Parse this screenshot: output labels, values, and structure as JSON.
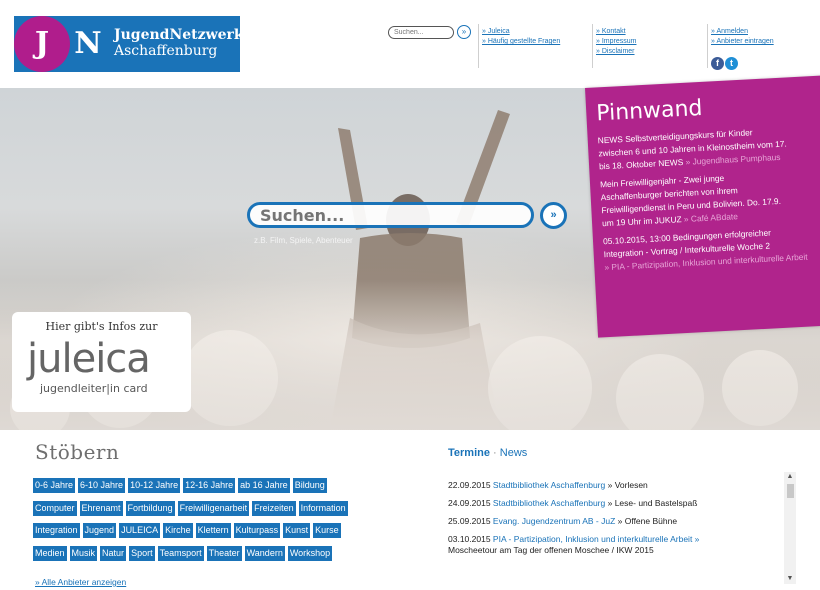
{
  "header": {
    "logo": {
      "letter_j": "J",
      "letter_n": "N",
      "line1": "JugendNetzwerk",
      "line2": "Aschaffenburg"
    },
    "search": {
      "placeholder": "Suchen...",
      "button": "»"
    },
    "links_col1": [
      "» Juleica",
      "» Häufig gestellte Fragen"
    ],
    "links_col2": [
      "» Kontakt",
      "» Impressum",
      "» Disclaimer"
    ],
    "links_col3": [
      "» Anmelden",
      "» Anbieter eintragen"
    ],
    "social": {
      "facebook": "f",
      "twitter": "t"
    }
  },
  "hero": {
    "search_placeholder": "Suchen...",
    "search_button": "»",
    "search_hint": "z.B. Film, Spiele, Abenteuer"
  },
  "juleica_card": {
    "intro": "Hier gibt's Infos zur",
    "wordmark": "juleica",
    "subline": "jugendleiter|in card"
  },
  "pinnwand": {
    "title": "Pinnwand",
    "items": [
      {
        "lines": [
          "NEWS Selbstverteidigungskurs für Kinder",
          "zwischen 6 und 10 Jahren in Kleinostheim vom 17.",
          "bis 18. Oktober NEWS "
        ],
        "link": "» Jugendhaus Pumphaus"
      },
      {
        "lines": [
          "Mein Freiwilligenjahr - Zwei junge",
          "Aschaffenburger berichten von ihrem",
          "Freiwilligendienst in Peru und Bolivien. Do. 17.9.",
          "um 19 Uhr im JUKUZ "
        ],
        "link": "» Café ABdate"
      },
      {
        "lines": [
          "05.10.2015, 13:00 Bedingungen erfolgreicher",
          "Integration - Vortrag / Interkulturelle Woche 2"
        ],
        "link": "» PIA - Partizipation, Inklusion und interkulturelle Arbeit"
      }
    ]
  },
  "stoebern": {
    "title": "Stöbern",
    "rows": [
      [
        "0-6 Jahre",
        "6-10 Jahre",
        "10-12 Jahre",
        "12-16 Jahre",
        "ab 16 Jahre",
        "Bildung"
      ],
      [
        "Computer",
        "Ehrenamt",
        "Fortbildung",
        "Freiwilligenarbeit",
        "Freizeiten",
        "Information"
      ],
      [
        "Integration",
        "Jugend",
        "JULEICA",
        "Kirche",
        "Klettern",
        "Kulturpass",
        "Kunst",
        "Kurse"
      ],
      [
        "Medien",
        "Musik",
        "Natur",
        "Sport",
        "Teamsport",
        "Theater",
        "Wandern",
        "Workshop"
      ]
    ],
    "all_link": "» Alle Anbieter anzeigen"
  },
  "termine": {
    "title": "Termine",
    "sep": "·",
    "news": "News",
    "rows": [
      {
        "date": "22.09.2015",
        "org": "Stadtbibliothek Aschaffenburg",
        "sep": " » ",
        "event": "Vorlesen"
      },
      {
        "date": "24.09.2015",
        "org": "Stadtbibliothek Aschaffenburg",
        "sep": " » ",
        "event": "Lese- und Bastelspaß"
      },
      {
        "date": "25.09.2015",
        "org": "Evang. Jugendzentrum AB - JuZ",
        "sep": " » ",
        "event": "Offene Bühne"
      },
      {
        "date": "03.10.2015",
        "org": "PIA - Partizipation, Inklusion und interkulturelle Arbeit »",
        "sep": "",
        "event": "Moscheetour am Tag der offenen Moschee / IKW 2015"
      }
    ],
    "scroll_up": "▲",
    "scroll_down": "▼"
  },
  "colors": {
    "brand_blue": "#1a73b8",
    "brand_magenta": "#b0248c"
  }
}
